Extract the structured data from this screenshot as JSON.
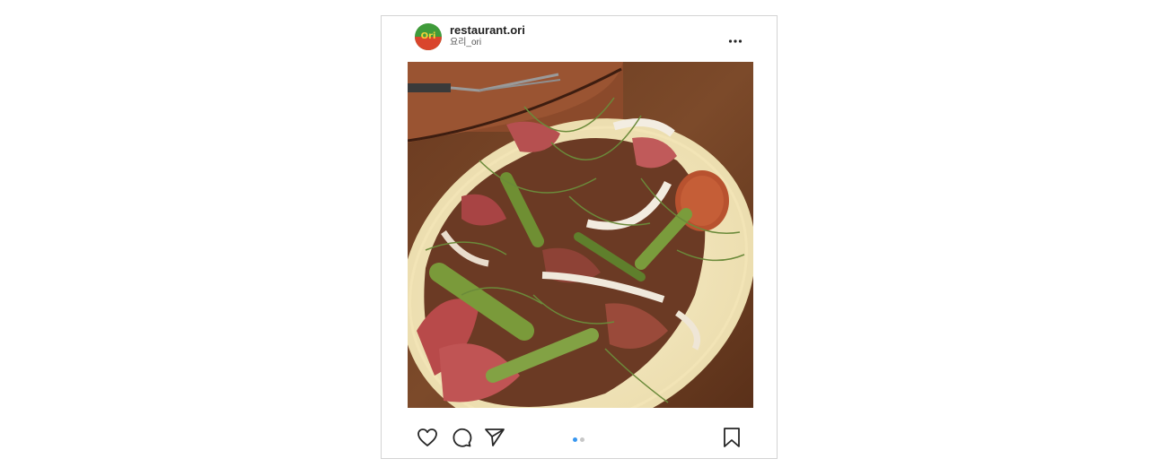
{
  "post": {
    "username": "restaurant.ori",
    "subtitle": "요리_ori",
    "avatar": {
      "text": "Ori",
      "colors": {
        "top": "#3f9b3a",
        "bottom": "#d9452c",
        "text": "#f4d23a"
      }
    },
    "image_alt": "grilled steak salad with asparagus, onions and herbs on an oval plate",
    "carousel": {
      "total": 2,
      "active_index": 0,
      "active_color": "#3897f0",
      "inactive_color": "#c7c7c7"
    },
    "icons": {
      "more": "more-options-icon",
      "like": "heart-icon",
      "comment": "comment-icon",
      "share": "send-icon",
      "save": "bookmark-icon"
    }
  }
}
